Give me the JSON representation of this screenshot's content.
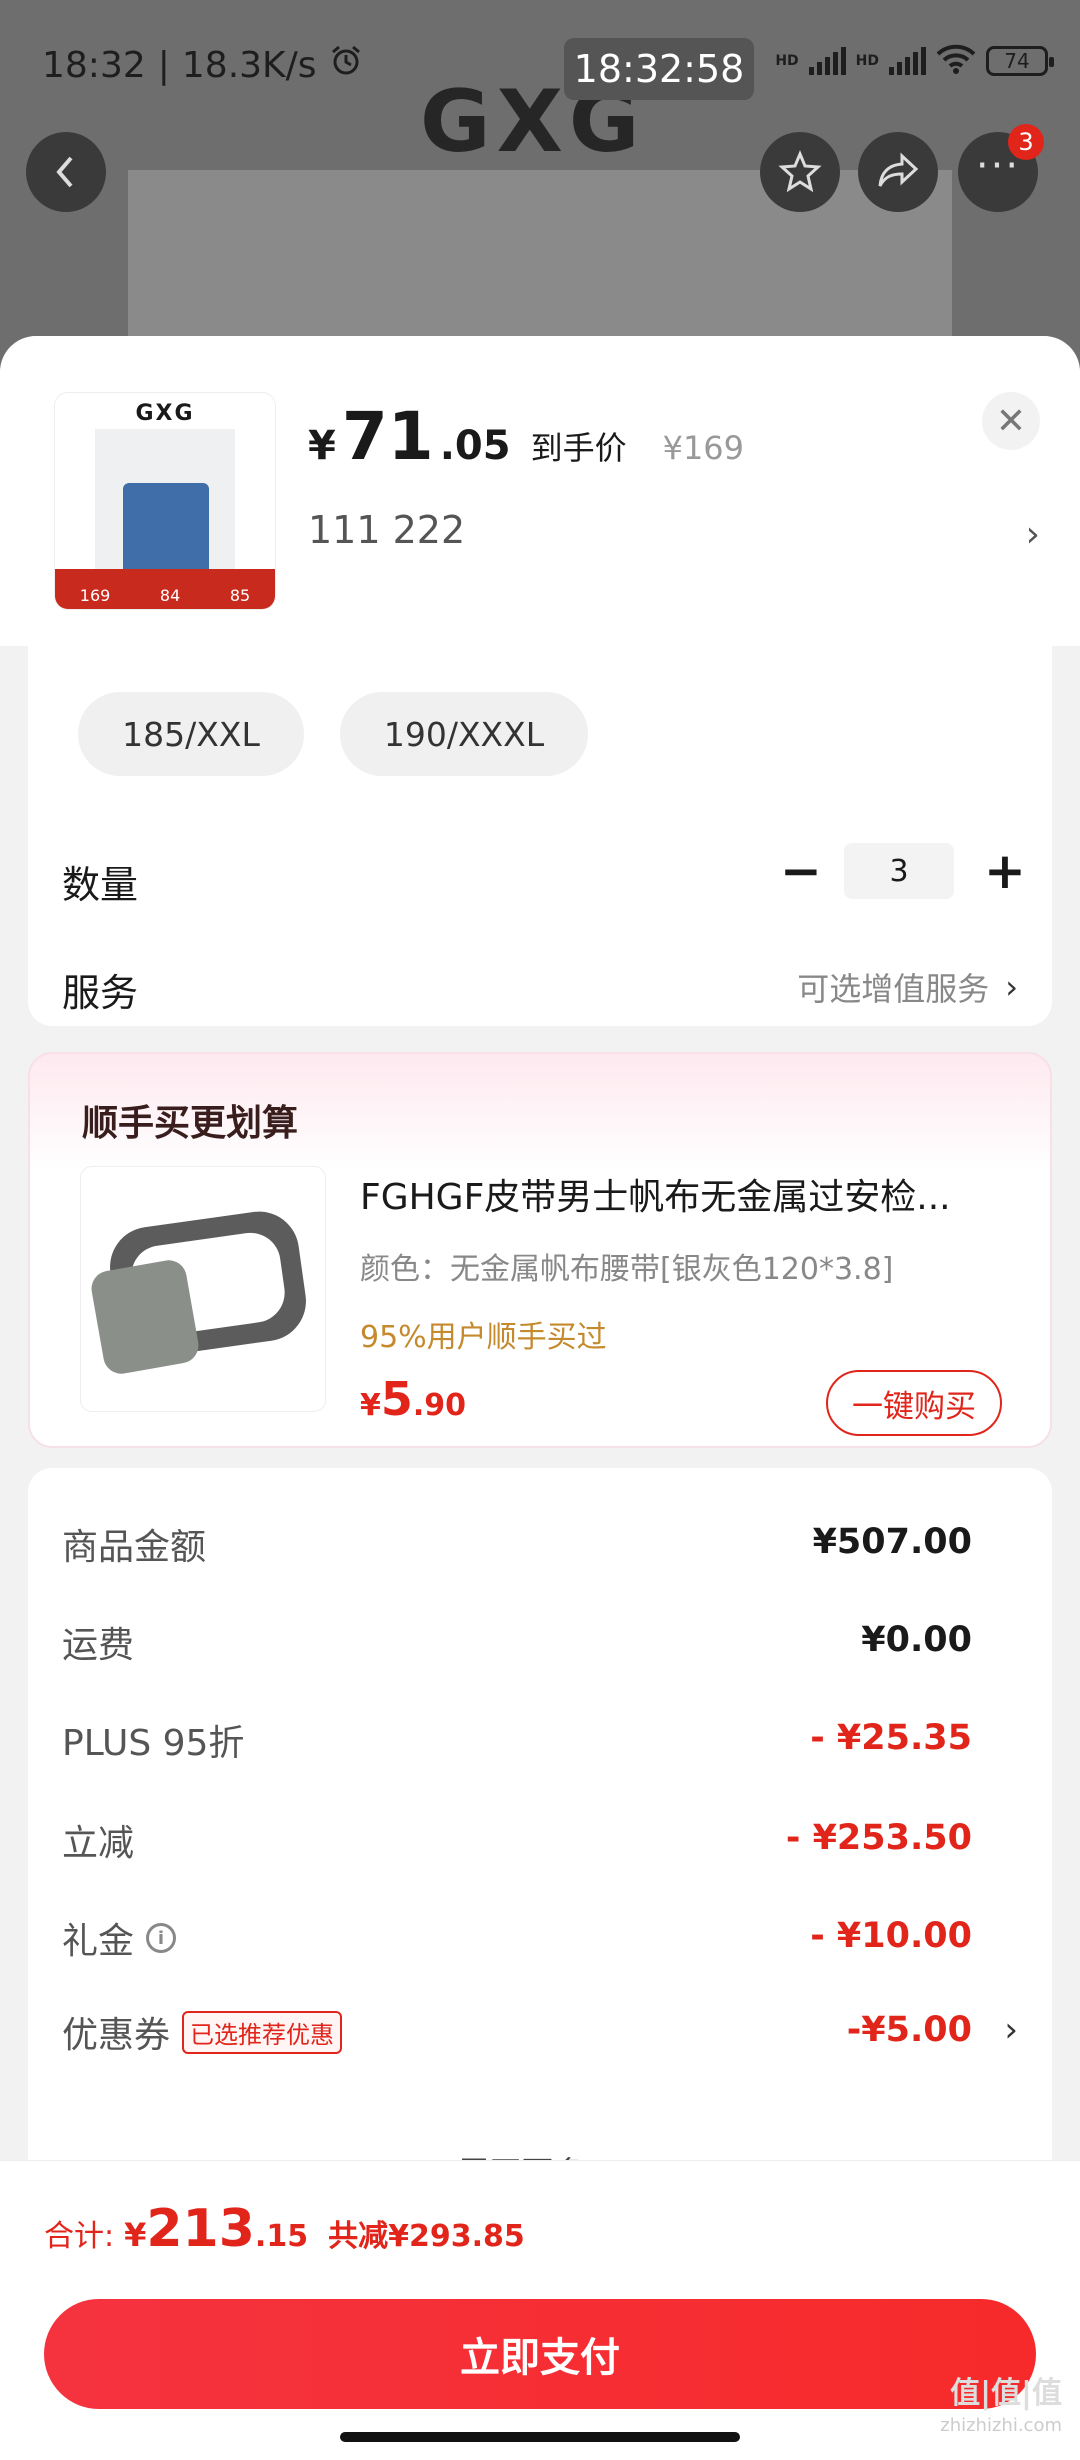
{
  "status_bar": {
    "time": "18:32",
    "net_speed": "18.3K/s",
    "clock_overlay": "18:32:58",
    "signal_label": "HD",
    "battery": "74"
  },
  "background": {
    "brand": "GXG",
    "more_badge": "3"
  },
  "product": {
    "thumb_logo": "GXG",
    "thumb_strip": [
      "169",
      "84",
      "85"
    ],
    "price_yen": "¥",
    "price_int": "71",
    "price_dec": ".05",
    "price_label": "到手价",
    "original_price": "¥169",
    "selected_spec": "111  222"
  },
  "sizes": {
    "visible_chips": [
      "185/XXL",
      "190/XXXL"
    ]
  },
  "quantity": {
    "label": "数量",
    "minus": "−",
    "value": "3",
    "plus": "+"
  },
  "service": {
    "label": "服务",
    "value": "可选增值服务"
  },
  "upsell": {
    "title": "顺手买更划算",
    "name": "FGHGF皮带男士帆布无金属过安检...",
    "attr": "颜色：无金属帆布腰带[银灰色120*3.8]",
    "percent_text": "95%用户顺手买过",
    "price_yen": "¥",
    "price_int": "5",
    "price_dec": ".90",
    "button": "一键购买"
  },
  "summary": {
    "rows": [
      {
        "label": "商品金额",
        "value": "¥507.00"
      },
      {
        "label": "运费",
        "value": "¥0.00"
      },
      {
        "label": "PLUS 95折",
        "value": "- ¥25.35"
      },
      {
        "label": "立减",
        "value": "- ¥253.50"
      },
      {
        "label": "礼金",
        "value": "- ¥10.00"
      },
      {
        "label": "优惠券",
        "tag": "已选推荐优惠",
        "value": "-¥5.00"
      }
    ],
    "expand_more": "展开更多 ⌄"
  },
  "footer": {
    "total_label": "合计:",
    "total_yen": "¥",
    "total_int": "213",
    "total_dec": ".15",
    "saved": "共减¥293.85",
    "pay_button": "立即支付"
  },
  "watermark": {
    "main": "值|值|值",
    "sub": "zhizhizhi.com"
  },
  "colors": {
    "accent_red": "#e1251b",
    "upsell_gold": "#c58a2e"
  }
}
